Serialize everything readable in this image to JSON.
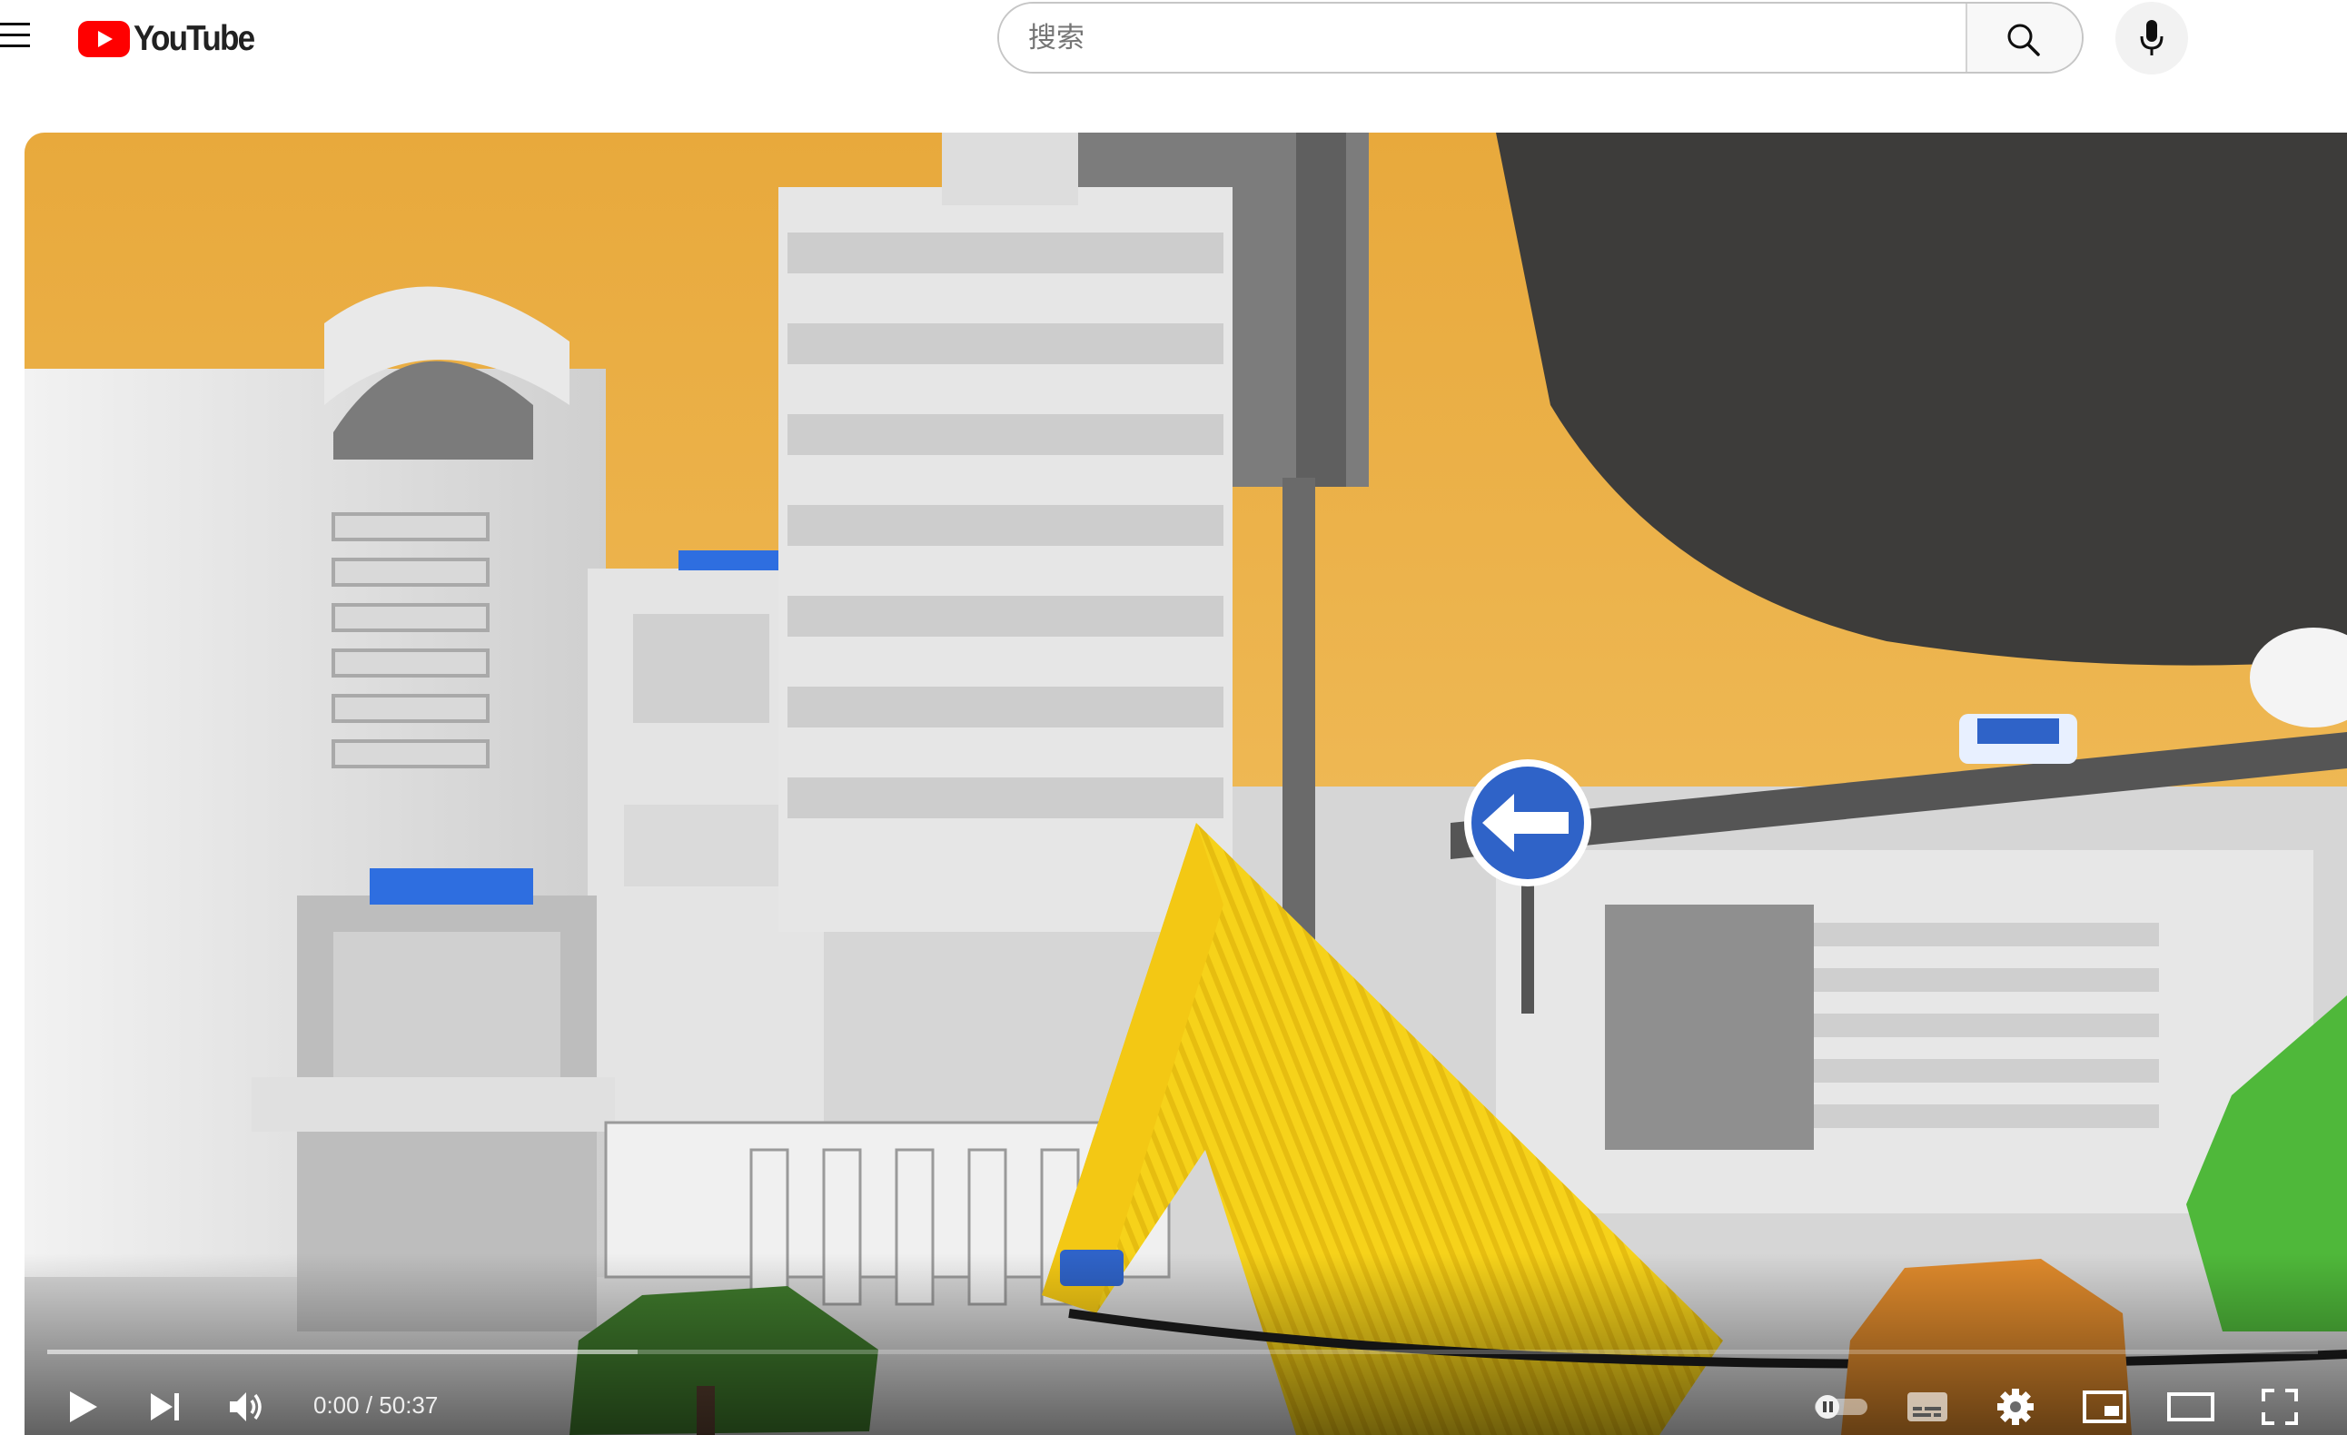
{
  "header": {
    "logo_text": "YouTube",
    "search_placeholder": "搜索"
  },
  "player": {
    "time_display": "0:00 / 50:37",
    "current_time": "0:00",
    "duration": "50:37",
    "progress_fraction": 0.0,
    "buffered_fraction": 0.26,
    "autoplay": "off"
  },
  "icons": {
    "menu": "hamburger-icon",
    "search": "search-icon",
    "mic": "microphone-icon",
    "play": "play-icon",
    "next": "skip-next-icon",
    "volume": "volume-icon",
    "autoplay": "autoplay-toggle-icon",
    "subtitles": "subtitles-icon",
    "settings": "gear-icon",
    "miniplayer": "miniplayer-icon",
    "theater": "theater-mode-icon",
    "fullscreen": "fullscreen-icon"
  },
  "colors": {
    "brand_red": "#ff0000",
    "sky_orange": "#f2b64a",
    "sign_blue": "#2f63c8"
  }
}
